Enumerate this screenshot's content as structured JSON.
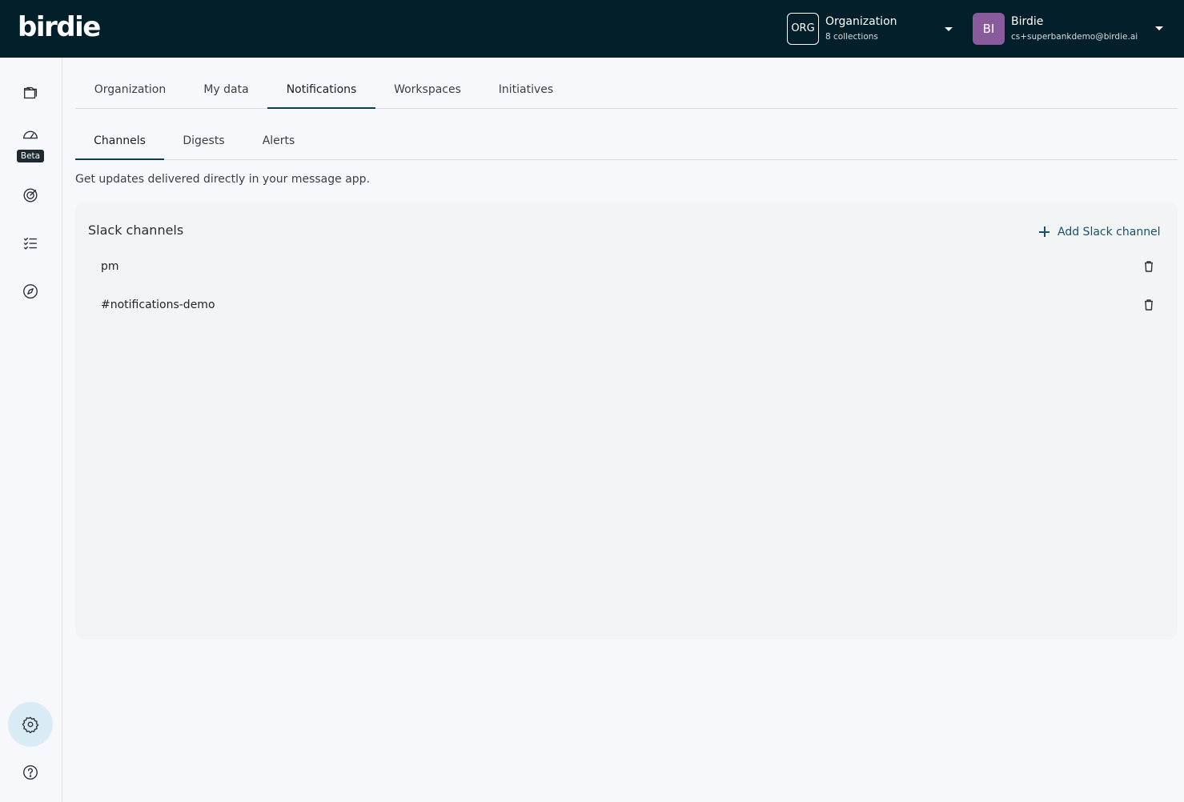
{
  "app": {
    "logo": "birdie"
  },
  "org": {
    "badge": "ORG",
    "name": "Organization",
    "subtitle": "8 collections"
  },
  "user": {
    "initials": "BI",
    "name": "Birdie",
    "email": "cs+superbankdemo@birdie.ai"
  },
  "sidebar": {
    "beta_label": "Beta",
    "items": [
      {
        "icon": "folder-icon"
      },
      {
        "icon": "dashboard-gauge-icon"
      },
      {
        "icon": "target-icon"
      },
      {
        "icon": "checklist-icon"
      },
      {
        "icon": "compass-icon"
      },
      {
        "icon": "gear-icon",
        "active": true
      },
      {
        "icon": "help-icon"
      }
    ]
  },
  "tabs": [
    {
      "label": "Organization"
    },
    {
      "label": "My data"
    },
    {
      "label": "Notifications",
      "active": true
    },
    {
      "label": "Workspaces"
    },
    {
      "label": "Initiatives"
    }
  ],
  "subtabs": [
    {
      "label": "Channels",
      "active": true
    },
    {
      "label": "Digests"
    },
    {
      "label": "Alerts"
    }
  ],
  "description": "Get updates delivered directly in your message app.",
  "panel": {
    "title": "Slack channels",
    "add_label": "Add Slack channel",
    "channels": [
      {
        "name": "pm"
      },
      {
        "name": "#notifications-demo"
      }
    ]
  },
  "colors": {
    "topbar": "#03202a",
    "accent": "#14526b",
    "avatar": "#8a5b9c",
    "active_nav": "#d9ecf5"
  }
}
